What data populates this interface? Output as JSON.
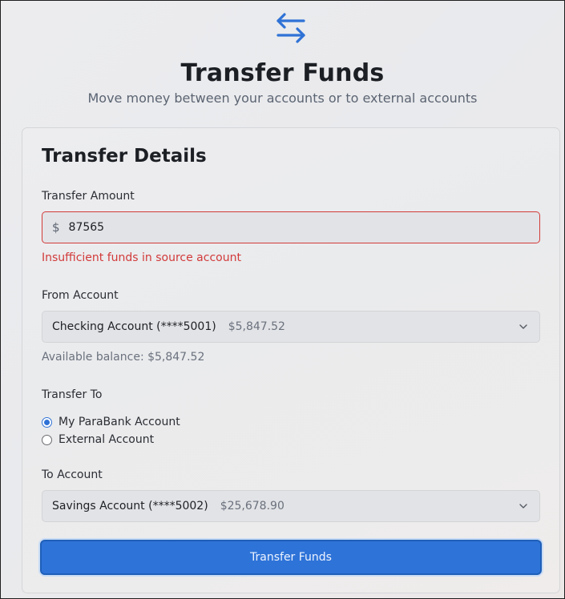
{
  "header": {
    "icon": "transfer-arrows-icon",
    "title": "Transfer Funds",
    "subtitle": "Move money between your accounts or to external accounts"
  },
  "form": {
    "title": "Transfer Details",
    "amount": {
      "label": "Transfer Amount",
      "currency": "$",
      "value": "87565",
      "error": "Insufficient funds in source account"
    },
    "from_account": {
      "label": "From Account",
      "selected_name": "Checking Account (****5001)",
      "selected_balance": "$5,847.52",
      "available_balance": "Available balance: $5,847.52"
    },
    "transfer_to": {
      "label": "Transfer To",
      "options": [
        {
          "label": "My ParaBank Account",
          "checked": true
        },
        {
          "label": "External Account",
          "checked": false
        }
      ]
    },
    "to_account": {
      "label": "To Account",
      "selected_name": "Savings Account (****5002)",
      "selected_balance": "$25,678.90"
    },
    "submit_label": "Transfer Funds"
  },
  "colors": {
    "accent": "#2e73d8",
    "error": "#d23a3a"
  }
}
